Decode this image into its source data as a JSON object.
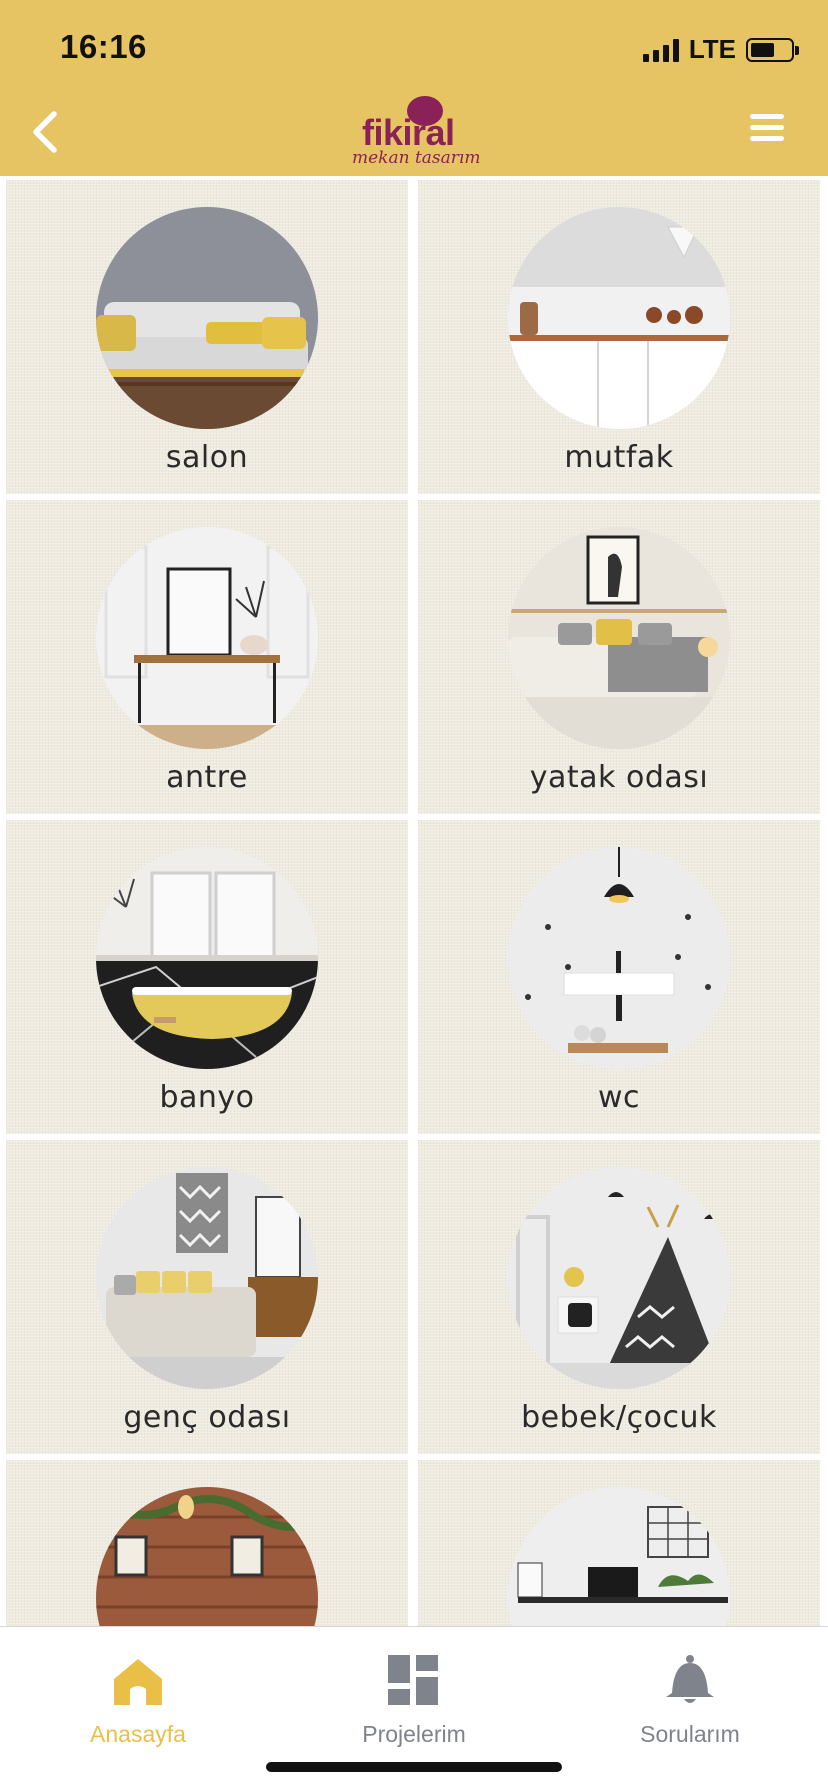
{
  "status_bar": {
    "time": "16:16",
    "network": "LTE"
  },
  "header": {
    "logo_main": "fikiral",
    "logo_sub": "mekan tasarım",
    "brand_color": "#8b2257",
    "bg_color": "#e7c463"
  },
  "rooms": [
    {
      "label": "salon"
    },
    {
      "label": "mutfak"
    },
    {
      "label": "antre"
    },
    {
      "label": "yatak odası"
    },
    {
      "label": "banyo"
    },
    {
      "label": "wc"
    },
    {
      "label": "genç odası"
    },
    {
      "label": "bebek/çocuk"
    }
  ],
  "tabbar": {
    "active_color": "#e9bf48",
    "inactive_color": "#7f848c",
    "tabs": [
      {
        "label": "Anasayfa",
        "icon": "home-icon"
      },
      {
        "label": "Projelerim",
        "icon": "grid-icon"
      },
      {
        "label": "Sorularım",
        "icon": "bell-icon"
      }
    ]
  }
}
